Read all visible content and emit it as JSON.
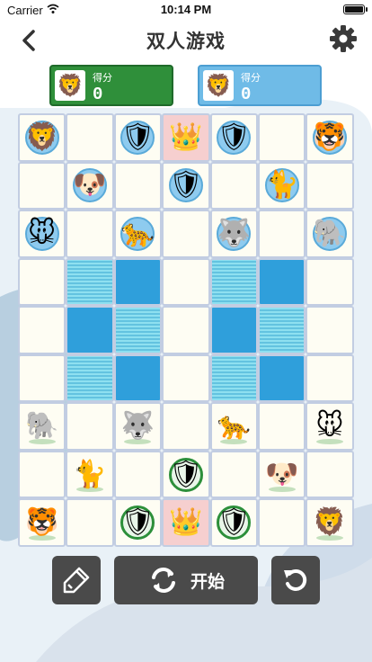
{
  "status_bar": {
    "carrier": "Carrier",
    "time": "10:14 PM",
    "battery_level": 1.0
  },
  "nav": {
    "title": "双人游戏"
  },
  "players": [
    {
      "score_label": "得分",
      "score": "0",
      "avatar": "🦁",
      "accent": "#2f8f3a"
    },
    {
      "score_label": "得分",
      "score": "0",
      "avatar": "🦁",
      "accent": "#6fbbe7"
    }
  ],
  "board": {
    "columns": 7,
    "rows": 9,
    "water_cells": [
      {
        "row": 3,
        "col": 1,
        "tone": "light"
      },
      {
        "row": 3,
        "col": 2,
        "tone": "deep"
      },
      {
        "row": 4,
        "col": 1,
        "tone": "deep"
      },
      {
        "row": 4,
        "col": 2,
        "tone": "light"
      },
      {
        "row": 5,
        "col": 1,
        "tone": "light"
      },
      {
        "row": 5,
        "col": 2,
        "tone": "deep"
      },
      {
        "row": 3,
        "col": 4,
        "tone": "light"
      },
      {
        "row": 3,
        "col": 5,
        "tone": "deep"
      },
      {
        "row": 4,
        "col": 4,
        "tone": "deep"
      },
      {
        "row": 4,
        "col": 5,
        "tone": "light"
      },
      {
        "row": 5,
        "col": 4,
        "tone": "light"
      },
      {
        "row": 5,
        "col": 5,
        "tone": "deep"
      }
    ],
    "home_cells": [
      {
        "row": 0,
        "col": 3
      },
      {
        "row": 8,
        "col": 3
      }
    ],
    "pieces": [
      {
        "row": 0,
        "col": 0,
        "icon": "lion",
        "glyph": "🦁",
        "side": "blue",
        "ring": "blue"
      },
      {
        "row": 0,
        "col": 2,
        "icon": "shield",
        "glyph": "🛡",
        "side": "blue",
        "ring": "blue"
      },
      {
        "row": 0,
        "col": 3,
        "icon": "crown",
        "glyph": "👑",
        "side": "blue",
        "ring": "none"
      },
      {
        "row": 0,
        "col": 4,
        "icon": "shield",
        "glyph": "🛡",
        "side": "blue",
        "ring": "blue"
      },
      {
        "row": 0,
        "col": 6,
        "icon": "tiger",
        "glyph": "🐯",
        "side": "blue",
        "ring": "blue"
      },
      {
        "row": 1,
        "col": 1,
        "icon": "dog",
        "glyph": "🐶",
        "side": "blue",
        "ring": "blue"
      },
      {
        "row": 1,
        "col": 3,
        "icon": "shield",
        "glyph": "🛡",
        "side": "blue",
        "ring": "blue"
      },
      {
        "row": 1,
        "col": 5,
        "icon": "cat",
        "glyph": "🐈",
        "side": "blue",
        "ring": "blue"
      },
      {
        "row": 2,
        "col": 0,
        "icon": "mouse",
        "glyph": "🐭",
        "side": "blue",
        "ring": "blue"
      },
      {
        "row": 2,
        "col": 2,
        "icon": "leopard",
        "glyph": "🐆",
        "side": "blue",
        "ring": "blue"
      },
      {
        "row": 2,
        "col": 4,
        "icon": "wolf",
        "glyph": "🐺",
        "side": "blue",
        "ring": "blue"
      },
      {
        "row": 2,
        "col": 6,
        "icon": "elephant",
        "glyph": "🐘",
        "side": "blue",
        "ring": "blue"
      },
      {
        "row": 6,
        "col": 0,
        "icon": "elephant",
        "glyph": "🐘",
        "side": "green",
        "ring": "shadow"
      },
      {
        "row": 6,
        "col": 2,
        "icon": "wolf",
        "glyph": "🐺",
        "side": "green",
        "ring": "shadow"
      },
      {
        "row": 6,
        "col": 4,
        "icon": "leopard",
        "glyph": "🐆",
        "side": "green",
        "ring": "shadow"
      },
      {
        "row": 6,
        "col": 6,
        "icon": "mouse",
        "glyph": "🐭",
        "side": "green",
        "ring": "shadow"
      },
      {
        "row": 7,
        "col": 1,
        "icon": "cat",
        "glyph": "🐈",
        "side": "green",
        "ring": "shadow"
      },
      {
        "row": 7,
        "col": 3,
        "icon": "shield",
        "glyph": "🛡",
        "side": "green",
        "ring": "green"
      },
      {
        "row": 7,
        "col": 5,
        "icon": "dog",
        "glyph": "🐶",
        "side": "green",
        "ring": "shadow"
      },
      {
        "row": 8,
        "col": 0,
        "icon": "tiger",
        "glyph": "🐯",
        "side": "green",
        "ring": "shadow"
      },
      {
        "row": 8,
        "col": 2,
        "icon": "shield",
        "glyph": "🛡",
        "side": "green",
        "ring": "green"
      },
      {
        "row": 8,
        "col": 3,
        "icon": "crown",
        "glyph": "👑",
        "side": "green",
        "ring": "none"
      },
      {
        "row": 8,
        "col": 4,
        "icon": "shield",
        "glyph": "🛡",
        "side": "green",
        "ring": "green"
      },
      {
        "row": 8,
        "col": 6,
        "icon": "lion",
        "glyph": "🦁",
        "side": "green",
        "ring": "shadow"
      }
    ]
  },
  "toolbar": {
    "start_label": "开始"
  },
  "colors": {
    "button": "#4a4a4a",
    "water_light": "#7dd3e8",
    "water_deep": "#2f9fdb",
    "home": "#f6cfcf"
  }
}
